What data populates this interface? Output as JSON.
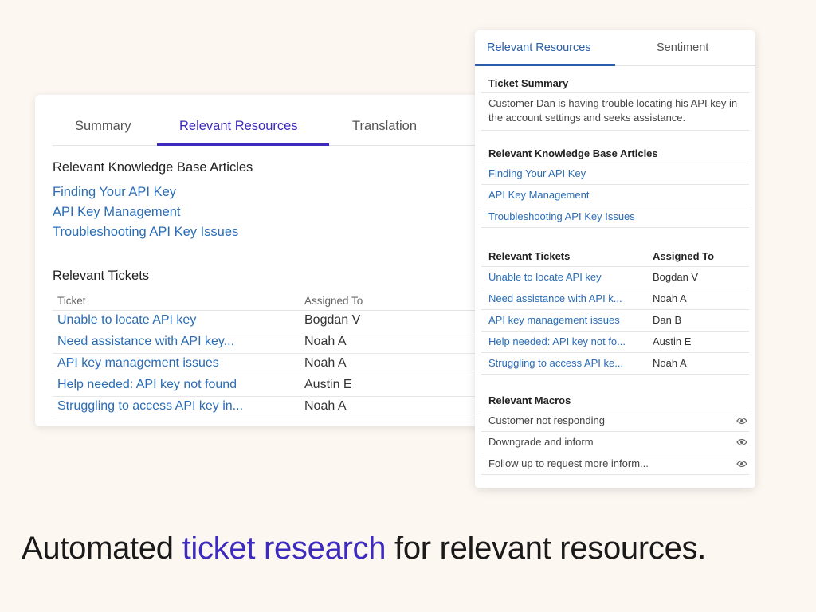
{
  "left_card": {
    "tabs": [
      "Summary",
      "Relevant Resources",
      "Translation"
    ],
    "active_tab": "Relevant Resources",
    "kb_title": "Relevant Knowledge Base Articles",
    "kb_links": [
      "Finding Your API Key",
      "API Key Management",
      "Troubleshooting API Key Issues"
    ],
    "tickets_title": "Relevant Tickets",
    "columns": [
      "Ticket",
      "Assigned To"
    ],
    "rows": [
      {
        "ticket": "Unable to locate API key",
        "assignee": "Bogdan V"
      },
      {
        "ticket": "Need assistance with API key...",
        "assignee": "Noah A"
      },
      {
        "ticket": "API key management issues",
        "assignee": "Noah A"
      },
      {
        "ticket": "Help needed: API key not found",
        "assignee": "Austin E"
      },
      {
        "ticket": "Struggling to access API key in...",
        "assignee": "Noah A"
      }
    ]
  },
  "right_card": {
    "tabs": [
      "Relevant Resources",
      "Sentiment"
    ],
    "active_tab": "Relevant Resources",
    "summary_title": "Ticket Summary",
    "summary_text": "Customer Dan is having trouble locating his API key in the account settings and seeks assistance.",
    "kb_title": "Relevant Knowledge Base Articles",
    "kb_links": [
      "Finding Your API Key",
      "API Key Management",
      "Troubleshooting API Key Issues"
    ],
    "tickets_header": [
      "Relevant Tickets",
      "Assigned To"
    ],
    "rows": [
      {
        "ticket": "Unable to locate API key",
        "assignee": "Bogdan V"
      },
      {
        "ticket": "Need assistance with API k...",
        "assignee": "Noah A"
      },
      {
        "ticket": "API key management issues",
        "assignee": "Dan B"
      },
      {
        "ticket": "Help needed: API key not fo...",
        "assignee": "Austin E"
      },
      {
        "ticket": "Struggling to access API ke...",
        "assignee": "Noah A"
      }
    ],
    "macros_title": "Relevant Macros",
    "macros": [
      "Customer not responding",
      "Downgrade and inform",
      "Follow up to request more inform..."
    ]
  },
  "tagline": {
    "prefix": "Automated ",
    "highlight": "ticket research",
    "suffix": " for relevant resources."
  },
  "colors": {
    "background": "#fdf7f2",
    "accent": "#3d2bbd",
    "link": "#2a6cb5",
    "right_tab_accent": "#2a5fa8"
  },
  "icons": [
    "eye-icon"
  ]
}
